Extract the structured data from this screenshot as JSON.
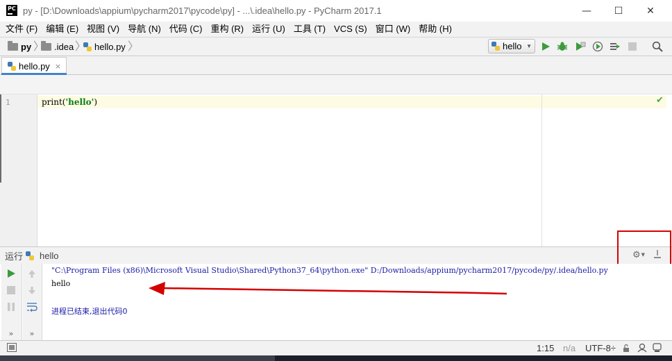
{
  "window": {
    "title": "py - [D:\\Downloads\\appium\\pycharm2017\\pycode\\py] - ...\\.idea\\hello.py - PyCharm 2017.1",
    "app_icon_text": "PC",
    "minimize_glyph": "—",
    "maximize_glyph": "☐",
    "close_glyph": "✕"
  },
  "menu": {
    "items": [
      "文件 (F)",
      "编辑 (E)",
      "视图 (V)",
      "导航 (N)",
      "代码 (C)",
      "重构 (R)",
      "运行 (U)",
      "工具 (T)",
      "VCS (S)",
      "窗口 (W)",
      "帮助 (H)"
    ]
  },
  "breadcrumbs": {
    "project": "py",
    "folder": ".idea",
    "file": "hello.py",
    "separator": "〉"
  },
  "toolbar": {
    "run_config": "hello",
    "icons": {
      "run": "run-icon",
      "debug": "debug-icon",
      "coverage": "coverage-icon",
      "profile": "profile-icon",
      "build": "build-icon",
      "stop": "stop-icon",
      "search": "search-icon"
    }
  },
  "editor": {
    "tab_label": "hello.py",
    "tab_close": "×",
    "line_number": "1",
    "code": {
      "fn": "print(",
      "string": "'hello'",
      "close": ")"
    },
    "inspection_mark": "✔"
  },
  "run_panel": {
    "title": "运行",
    "config_name": "hello",
    "console": [
      "\"C:\\Program Files (x86)\\Microsoft Visual Studio\\Shared\\Python37_64\\python.exe\" D:/Downloads/appium/pycharm2017/pycode/py/.idea/hello.py",
      "hello",
      "",
      "进程已结束,退出代码0"
    ],
    "colors": {
      "command": "#1a1aa6",
      "output": "#000000",
      "exit": "#1a1aa6"
    }
  },
  "statusbar": {
    "position": "1:15",
    "line_separator": "n/a",
    "encoding": "UTF-8÷"
  },
  "annotation": {
    "color": "#d40000"
  }
}
